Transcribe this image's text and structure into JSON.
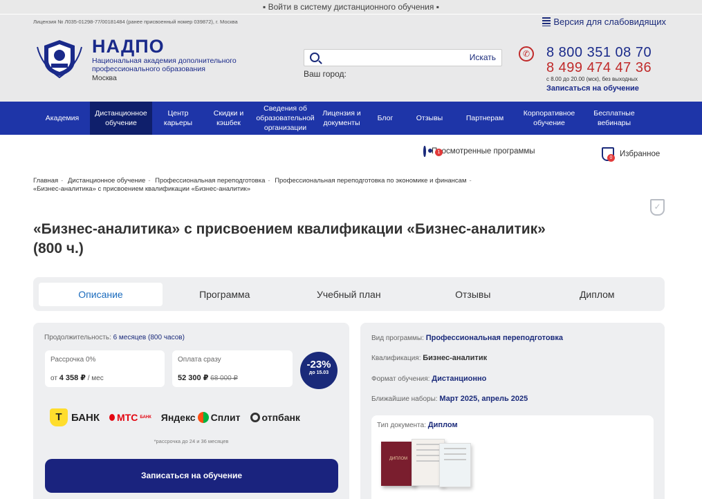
{
  "topbar": {
    "login_text": "▪ Войти в систему дистанционного обучения ▪"
  },
  "license_row": {
    "license": "Лицензия № Л035-01298-77/00181484 (ранее присвоенный номер 039872), г. Москва",
    "vision": "Версия для слабовидящих"
  },
  "brand": {
    "name": "НАДПО",
    "subtitle": "Национальная академия дополнительного профессионального образования",
    "city": "Москва"
  },
  "search": {
    "placeholder": "",
    "button": "Искать",
    "city_label": "Ваш город:"
  },
  "contacts": {
    "phone1": "8 800 351 08 70",
    "phone2": "8 499 474 47 36",
    "hours": "с 8.00 до 20.00 (мск), без выходных",
    "enroll": "Записаться на обучение"
  },
  "nav": [
    {
      "label": "Академия"
    },
    {
      "label": "Дистанционное обучение"
    },
    {
      "label": "Центр карьеры"
    },
    {
      "label": "Скидки и кэшбек"
    },
    {
      "label": "Сведения об образовательной организации"
    },
    {
      "label": "Лицензия и документы"
    },
    {
      "label": "Блог"
    },
    {
      "label": "Отзывы"
    },
    {
      "label": "Партнерам"
    },
    {
      "label": "Корпоративное обучение"
    },
    {
      "label": "Бесплатные вебинары"
    }
  ],
  "tools": {
    "viewed": "Просмотренные программы",
    "viewed_count": "1",
    "favorites": "Избранное",
    "favorites_count": "0"
  },
  "breadcrumbs": [
    "Главная",
    "Дистанционное обучение",
    "Профессиональная переподготовка",
    "Профессиональная переподготовка по экономике и финансам",
    "«Бизнес-аналитика» с присвоением квалификации «Бизнес-аналитик»"
  ],
  "title": "«Бизнес-аналитика» с присвоением квалификации «Бизнес-аналитик» (800 ч.)",
  "tabs": [
    "Описание",
    "Программа",
    "Учебный план",
    "Отзывы",
    "Диплом"
  ],
  "pricing": {
    "duration_label": "Продолжительность:",
    "duration_value": "6 месяцев (800 часов)",
    "installment_label": "Рассрочка 0%",
    "installment_prefix": "от",
    "installment_amount": "4 358 ₽",
    "installment_suffix": "/ мес",
    "full_label": "Оплата сразу",
    "full_price": "52 300 ₽",
    "old_price": "68 000 ₽",
    "discount": "-23%",
    "discount_until": "до 15.03",
    "note": "*рассрочка до 24 и 36 месяцев",
    "cta": "Записаться на обучение"
  },
  "banks": {
    "tbank": "БАНК",
    "tbank_logo": "Т",
    "mts": "МТС",
    "mts_small": "БАНК",
    "yandex": "Яндекс",
    "split": "Сплит",
    "otp": "отпбанк"
  },
  "program_info": {
    "type_label": "Вид программы:",
    "type_value": "Профессиональная переподготовка",
    "qual_label": "Квалификация:",
    "qual_value": "Бизнес-аналитик",
    "format_label": "Формат обучения:",
    "format_value": "Дистанционно",
    "sets_label": "Ближайшие наборы:",
    "sets_value": "Март 2025, апрель 2025",
    "doc_label": "Тип документа:",
    "doc_value": "Диплом",
    "diploma_text": "ДИПЛОМ"
  }
}
